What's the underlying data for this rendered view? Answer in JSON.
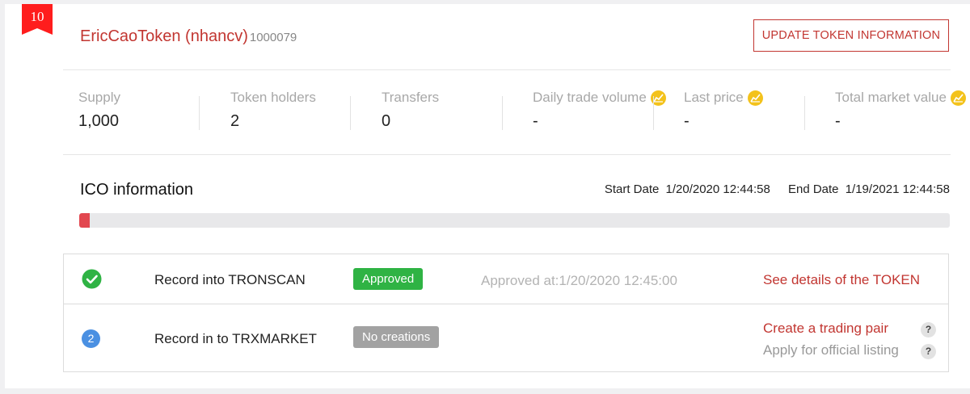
{
  "rank": "10",
  "token": {
    "name": "EricCaoToken (nhancv)",
    "id": "1000079"
  },
  "update_button": "UPDATE TOKEN INFORMATION",
  "stats": [
    {
      "label": "Supply",
      "value": "1,000"
    },
    {
      "label": "Token holders",
      "value": "2"
    },
    {
      "label": "Transfers",
      "value": "0"
    },
    {
      "label": "Daily trade volume",
      "value": "-",
      "icon": "coin-chart-icon"
    },
    {
      "label": "Last price",
      "value": "-",
      "icon": "coin-chart-icon"
    },
    {
      "label": "Total market value",
      "value": "-",
      "icon": "coin-chart-icon"
    }
  ],
  "ico": {
    "title": "ICO information",
    "start_label": "Start Date",
    "start_value": "1/20/2020 12:44:58",
    "end_label": "End Date",
    "end_value": "1/19/2021 12:44:58",
    "progress_fraction": 0.012
  },
  "records": {
    "row1": {
      "label": "Record into TRONSCAN",
      "status": "Approved",
      "approved_at": "Approved at:1/20/2020 12:45:00",
      "link": "See details of the TOKEN"
    },
    "row2": {
      "step": "2",
      "label": "Record in to TRXMARKET",
      "status": "No creations",
      "link1": "Create a trading pair",
      "link2": "Apply for official listing",
      "help": "?"
    }
  },
  "colors": {
    "accent_red": "#c23631",
    "approved_green": "#2fb344",
    "step_blue": "#4a90e2",
    "coin_gold": "#f3c21b"
  }
}
